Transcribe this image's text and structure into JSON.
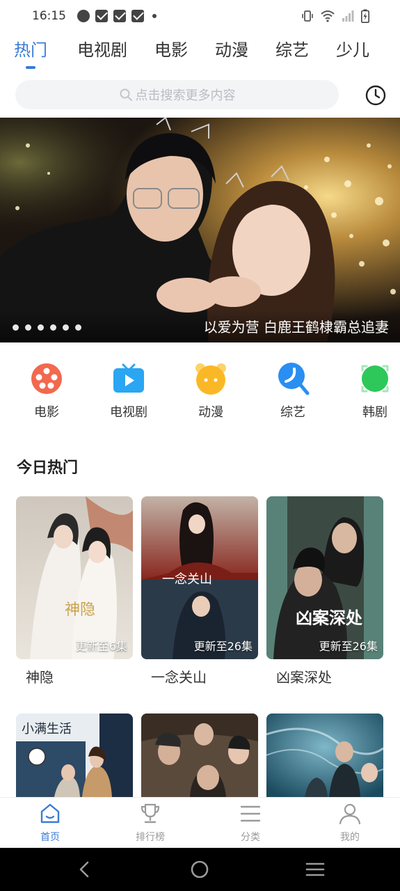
{
  "status_bar": {
    "time": "16:15"
  },
  "tabs": [
    {
      "label": "热门",
      "active": true
    },
    {
      "label": "电视剧",
      "active": false
    },
    {
      "label": "电影",
      "active": false
    },
    {
      "label": "动漫",
      "active": false
    },
    {
      "label": "综艺",
      "active": false
    },
    {
      "label": "少儿",
      "active": false
    }
  ],
  "search": {
    "placeholder": "点击搜索更多内容",
    "icon": "search-icon"
  },
  "history_button": {
    "icon": "clock-icon"
  },
  "banner": {
    "caption": "以爱为营 白鹿王鹤棣霸总追妻",
    "dot_count": 6
  },
  "categories": [
    {
      "label": "电影",
      "icon": "film-reel-icon",
      "color": "#f2694f"
    },
    {
      "label": "电视剧",
      "icon": "tv-icon",
      "color": "#2aa6f2"
    },
    {
      "label": "动漫",
      "icon": "cartoon-face-icon",
      "color": "#fbb826"
    },
    {
      "label": "综艺",
      "icon": "microphone-icon",
      "color": "#2a8ef2"
    },
    {
      "label": "韩剧",
      "icon": "korean-drama-icon",
      "color": "#2ec85a"
    }
  ],
  "section": {
    "title": "今日热门"
  },
  "cards": [
    {
      "title": "神隐",
      "badge": "更新至6集"
    },
    {
      "title": "一念关山",
      "badge": "更新至26集"
    },
    {
      "title": "凶案深处",
      "badge": "更新至26集"
    }
  ],
  "poster_texts": {
    "card1_brush": "神隐",
    "card2_brush": "一念关山",
    "card3_brush": "凶案深处",
    "row2_card1": "小满生活"
  },
  "bottom_nav": [
    {
      "label": "首页",
      "icon": "home-icon",
      "active": true
    },
    {
      "label": "排行榜",
      "icon": "trophy-icon",
      "active": false
    },
    {
      "label": "分类",
      "icon": "list-icon",
      "active": false
    },
    {
      "label": "我的",
      "icon": "user-icon",
      "active": false
    }
  ],
  "colors": {
    "accent": "#3a7bd5",
    "inactive": "#9a9a9a",
    "search_bg": "#f3f4f6"
  }
}
